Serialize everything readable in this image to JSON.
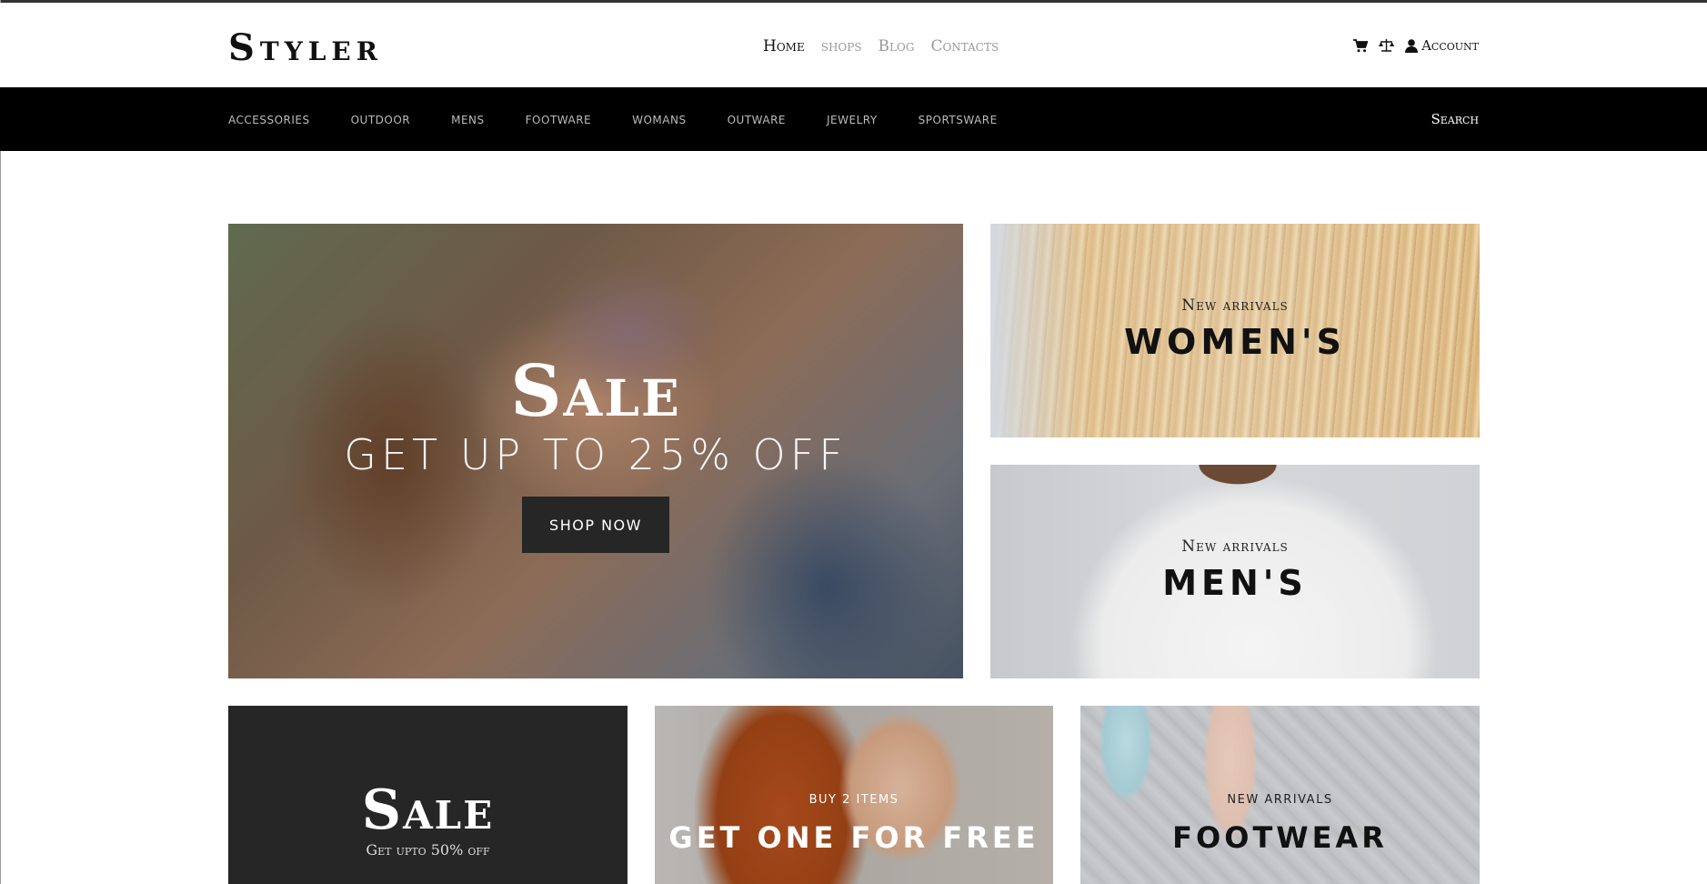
{
  "brand": {
    "logo": "Styler"
  },
  "main_nav": [
    {
      "label": "Home",
      "active": true
    },
    {
      "label": "shops",
      "active": false
    },
    {
      "label": "Blog",
      "active": false
    },
    {
      "label": "Contacts",
      "active": false
    }
  ],
  "utils": {
    "cart_icon": "cart-icon",
    "compare_icon": "balance-scale-icon",
    "user_icon": "user-icon",
    "account_label": "Account"
  },
  "categories": [
    "accessories",
    "outdoor",
    "mens",
    "footware",
    "womans",
    "outware",
    "jewelry",
    "sportsware"
  ],
  "search_label": "Search",
  "hero": {
    "title": "Sale",
    "subtitle": "GET UP TO 25% OFF",
    "button_label": "SHOP NOW"
  },
  "promos": {
    "women": {
      "label": "New arrivals",
      "title": "WOMEN'S"
    },
    "men": {
      "label": "New arrivals",
      "title": "MEN'S"
    },
    "sale": {
      "title": "Sale",
      "subtitle": "Get upto 50% off"
    },
    "free": {
      "label": "BUY 2 ITEMS",
      "title": "GET ONE FOR FREE"
    },
    "footwear": {
      "label": "NEW ARRIVALS",
      "title": "FOOTWEAR"
    }
  },
  "colors": {
    "nav_bar": "#000000",
    "button_bg": "#262626",
    "muted_nav": "#999999"
  }
}
